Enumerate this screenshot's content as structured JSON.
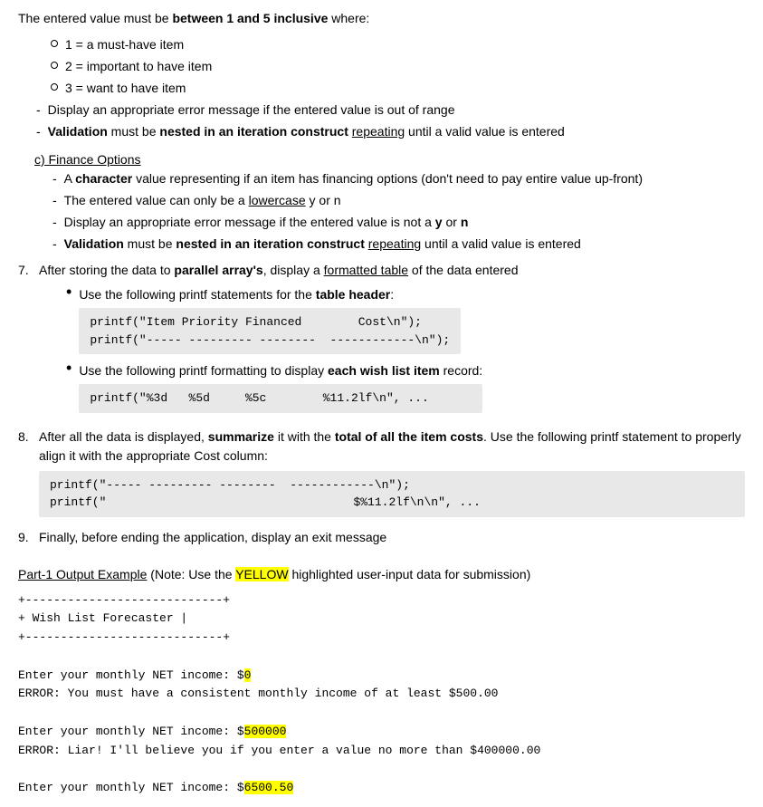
{
  "top_note": "The entered value must be between 1 and 5 inclusive where:",
  "circle_items": [
    {
      "text": "1 = a must-have item"
    },
    {
      "text": "2 = important to have item"
    },
    {
      "text": "3 = want to have item"
    }
  ],
  "dash_items_priority": [
    {
      "text": "Display an appropriate error message if the entered value is out of range"
    },
    {
      "text_parts": [
        "Validation",
        " must be ",
        "nested in an iteration construct ",
        "repeating",
        " until a valid value is entered"
      ]
    }
  ],
  "section_c_label": "c) Finance Options",
  "section_c_dashes": [
    {
      "text_parts": [
        "A ",
        "character",
        " value representing if an item has financing options (don’t need to pay entire value up-front)"
      ]
    },
    {
      "text_parts": [
        "The entered value can only be a ",
        "lowercase",
        " y or n"
      ]
    },
    {
      "text": "Display an appropriate error message if the entered value is not a y or n"
    },
    {
      "text_parts": [
        "Validation",
        " must be ",
        "nested in an iteration construct ",
        "repeating",
        " until a valid value is entered"
      ]
    }
  ],
  "item7": {
    "number": "7.",
    "text_parts": [
      "After storing the data to ",
      "parallel array’s",
      ", display a ",
      "formatted table",
      " of the data entered"
    ],
    "bullets": [
      {
        "text_parts": [
          "Use the following printf statements for the ",
          "table header",
          ":"
        ],
        "code": "printf(\"Item Priority Financed        Cost\\n\");\nprintf(\"----- --------- --------  ------------\\n\");"
      },
      {
        "text_parts": [
          "Use the following printf formatting to display ",
          "each wish list item",
          " record:"
        ],
        "code": "printf(\"%3d   %5d     %5c        %11.2lf\\n\", ..."
      }
    ]
  },
  "item8": {
    "number": "8.",
    "text_parts": [
      "After all the data is displayed, ",
      "summarize",
      " it with the ",
      "total of all the item costs",
      ".  Use the following printf statement to properly align it with the appropriate Cost column:"
    ],
    "code": "printf(\"----- --------- --------  ------------\\n\");\nprintf(\"                                   $%11.2lf\\n\\n\", ..."
  },
  "item9": {
    "number": "9.",
    "text": "Finally, before ending the application, display an exit message"
  },
  "part1_label": "Part-1 Output Example",
  "part1_note": " (Note: Use the ",
  "yellow_label": "YELLOW",
  "part1_note2": " highlighted user-input data for submission)",
  "terminal_lines": [
    {
      "text": "+----------------------------+",
      "type": "normal"
    },
    {
      "text": "+   Wish List Forecaster   |",
      "type": "normal"
    },
    {
      "text": "+----------------------------+",
      "type": "normal"
    },
    {
      "text": "",
      "type": "blank"
    },
    {
      "text_before": "Enter your monthly NET income: $",
      "highlight": "0",
      "type": "input"
    },
    {
      "text": "ERROR: You must have a consistent monthly income of at least $500.00",
      "type": "normal"
    },
    {
      "text": "",
      "type": "blank"
    },
    {
      "text_before": "Enter your monthly NET income: $",
      "highlight": "500000",
      "type": "input"
    },
    {
      "text": "ERROR: Liar! I'll believe you if you enter a value no more than $400000.00",
      "type": "normal"
    },
    {
      "text": "",
      "type": "blank"
    },
    {
      "text_before": "Enter your monthly NET income: $",
      "highlight": "6500.50",
      "type": "input"
    }
  ]
}
